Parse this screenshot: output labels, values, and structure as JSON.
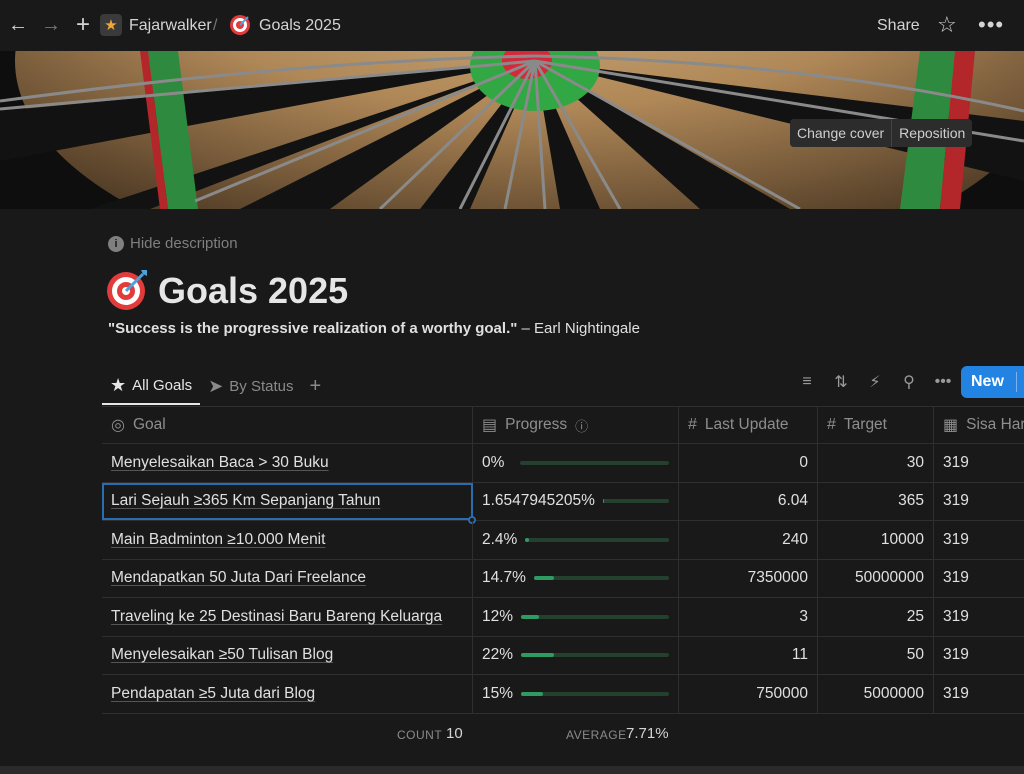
{
  "topbar": {
    "workspace": "Fajarwalker",
    "separator": "/",
    "page": "Goals 2025",
    "share_label": "Share"
  },
  "cover": {
    "change_label": "Change cover",
    "reposition_label": "Reposition"
  },
  "page": {
    "hide_description_label": "Hide description",
    "title": "Goals 2025",
    "quote_text": "\"Success is the progressive realization of a worthy goal.\"",
    "quote_author": " – Earl Nightingale"
  },
  "views": {
    "tabs": [
      {
        "label": "All Goals",
        "active": true
      },
      {
        "label": "By Status",
        "active": false
      }
    ],
    "new_label": "New"
  },
  "table": {
    "columns": [
      "Goal",
      "Progress",
      "Last Update",
      "Target",
      "Sisa Har"
    ],
    "rows": [
      {
        "goal": "Menyelesaikan Baca > 30 Buku",
        "progress_text": "0%",
        "progress": 0,
        "last_update": "0",
        "target": "30",
        "sisa": "319"
      },
      {
        "goal": "Lari Sejauh ≥365 Km Sepanjang Tahun",
        "progress_text": "1.6547945205%",
        "progress": 0.0165,
        "last_update": "6.04",
        "target": "365",
        "sisa": "319"
      },
      {
        "goal": "Main Badminton ≥10.000 Menit",
        "progress_text": "2.4%",
        "progress": 0.024,
        "last_update": "240",
        "target": "10000",
        "sisa": "319"
      },
      {
        "goal": "Mendapatkan 50 Juta Dari Freelance",
        "progress_text": "14.7%",
        "progress": 0.147,
        "last_update": "7350000",
        "target": "50000000",
        "sisa": "319"
      },
      {
        "goal": "Traveling ke 25 Destinasi Baru Bareng Keluarga",
        "progress_text": "12%",
        "progress": 0.12,
        "last_update": "3",
        "target": "25",
        "sisa": "319"
      },
      {
        "goal": "Menyelesaikan ≥50 Tulisan Blog",
        "progress_text": "22%",
        "progress": 0.22,
        "last_update": "11",
        "target": "50",
        "sisa": "319"
      },
      {
        "goal": "Pendapatan ≥5 Juta dari Blog",
        "progress_text": "15%",
        "progress": 0.15,
        "last_update": "750000",
        "target": "5000000",
        "sisa": "319"
      }
    ],
    "selected_row": 1
  },
  "footer": {
    "count_label": "COUNT",
    "count_value": "10",
    "average_label": "AVERAGE",
    "average_value": "7.71%"
  },
  "colors": {
    "accent": "#2383e2",
    "progress_fill": "#2e9b63",
    "progress_track": "#24402f"
  }
}
